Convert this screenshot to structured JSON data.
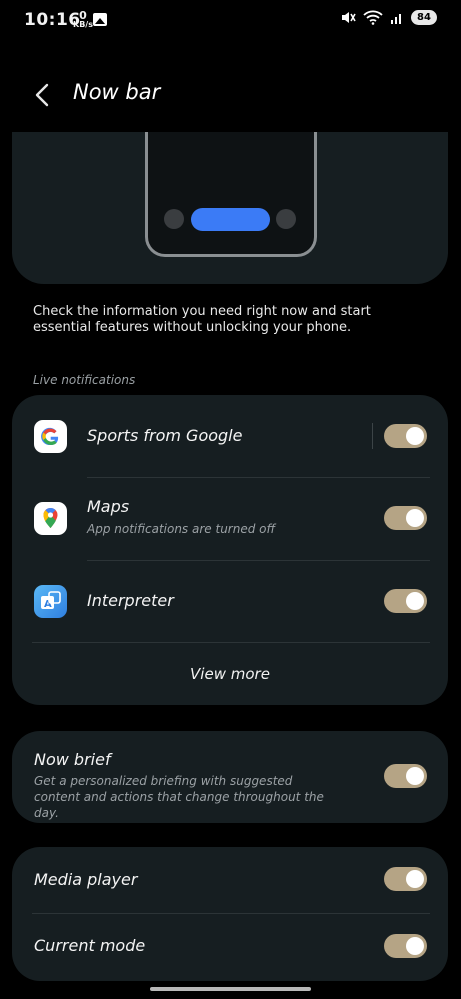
{
  "status_bar": {
    "time": "10:16",
    "net_speed_value": "0",
    "net_speed_unit": "KB/s",
    "battery": "84"
  },
  "header": {
    "title": "Now bar"
  },
  "description": "Check the information you need right now and start essential features without unlocking your phone.",
  "live_notifications": {
    "label": "Live notifications",
    "items": [
      {
        "name": "Sports from Google",
        "subtitle": "",
        "enabled": true,
        "icon": "google-icon"
      },
      {
        "name": "Maps",
        "subtitle": "App notifications are turned off",
        "enabled": true,
        "icon": "maps-icon"
      },
      {
        "name": "Interpreter",
        "subtitle": "",
        "enabled": true,
        "icon": "interpreter-icon"
      }
    ],
    "view_more": "View more"
  },
  "now_brief": {
    "title": "Now brief",
    "subtitle": "Get a personalized briefing with suggested content and actions that change throughout the day.",
    "enabled": true
  },
  "media_player": {
    "title": "Media player",
    "enabled": true
  },
  "current_mode": {
    "title": "Current mode",
    "enabled": true
  },
  "colors": {
    "background": "#000000",
    "card": "#161e21",
    "toggle_on": "#b5a485",
    "accent_pill": "#3b7bf6"
  }
}
